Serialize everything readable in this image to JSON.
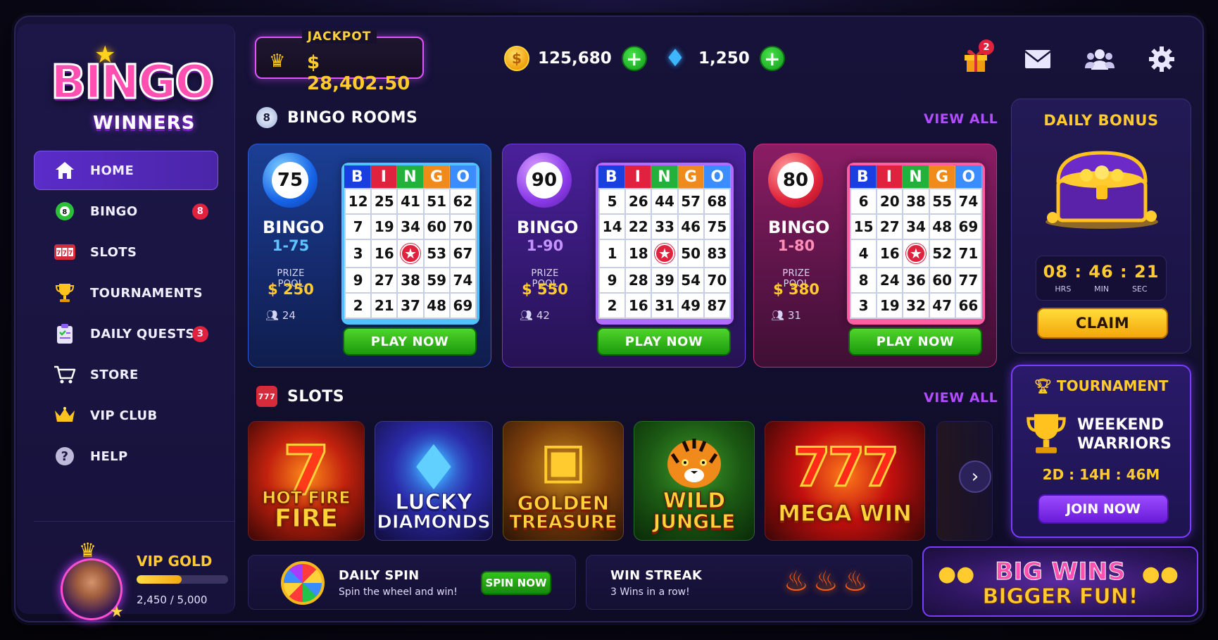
{
  "brand": {
    "line1": "BINGO",
    "line2": "WINNERS"
  },
  "nav": {
    "items": [
      {
        "label": "HOME",
        "icon": "home-icon",
        "active": true
      },
      {
        "label": "BINGO",
        "icon": "bingo-ball-icon",
        "badge": "8"
      },
      {
        "label": "SLOTS",
        "icon": "slot-machine-icon"
      },
      {
        "label": "TOURNAMENTS",
        "icon": "trophy-icon"
      },
      {
        "label": "DAILY QUESTS",
        "icon": "clipboard-icon",
        "badge": "3"
      },
      {
        "label": "STORE",
        "icon": "cart-icon"
      },
      {
        "label": "VIP CLUB",
        "icon": "crown-icon"
      },
      {
        "label": "HELP",
        "icon": "help-icon"
      }
    ]
  },
  "vip": {
    "level": "VIP GOLD",
    "progress_text": "2,450 / 5,000",
    "progress": 0.49
  },
  "header": {
    "jackpot_label": "JACKPOT",
    "jackpot_amount": "$ 28,402.50",
    "coins": "125,680",
    "gems": "1,250",
    "gift_badge": "2"
  },
  "rooms_section": {
    "title": "BINGO ROOMS",
    "view_all": "VIEW ALL"
  },
  "rooms": [
    {
      "ball": "75",
      "name": "BINGO",
      "range": "1-75",
      "prize_label": "PRIZE POOL",
      "prize": "$ 250",
      "players": "24",
      "play": "PLAY NOW",
      "letters": [
        "B",
        "I",
        "N",
        "G",
        "O"
      ],
      "grid": [
        [
          "12",
          "25",
          "41",
          "51",
          "62"
        ],
        [
          "7",
          "19",
          "34",
          "60",
          "70"
        ],
        [
          "3",
          "16",
          "★",
          "53",
          "67"
        ],
        [
          "9",
          "27",
          "38",
          "59",
          "74"
        ],
        [
          "2",
          "21",
          "37",
          "48",
          "69"
        ]
      ]
    },
    {
      "ball": "90",
      "name": "BINGO",
      "range": "1-90",
      "prize_label": "PRIZE POOL",
      "prize": "$ 550",
      "players": "42",
      "play": "PLAY NOW",
      "letters": [
        "B",
        "I",
        "N",
        "G",
        "O"
      ],
      "grid": [
        [
          "5",
          "26",
          "44",
          "57",
          "68"
        ],
        [
          "14",
          "22",
          "33",
          "46",
          "75"
        ],
        [
          "1",
          "18",
          "★",
          "50",
          "83"
        ],
        [
          "9",
          "28",
          "39",
          "54",
          "70"
        ],
        [
          "2",
          "16",
          "31",
          "49",
          "87"
        ]
      ]
    },
    {
      "ball": "80",
      "name": "BINGO",
      "range": "1-80",
      "prize_label": "PRIZE POOL",
      "prize": "$ 380",
      "players": "31",
      "play": "PLAY NOW",
      "letters": [
        "B",
        "I",
        "N",
        "G",
        "O"
      ],
      "grid": [
        [
          "6",
          "20",
          "38",
          "55",
          "74"
        ],
        [
          "15",
          "27",
          "34",
          "48",
          "69"
        ],
        [
          "4",
          "16",
          "★",
          "52",
          "71"
        ],
        [
          "8",
          "24",
          "36",
          "60",
          "77"
        ],
        [
          "3",
          "19",
          "32",
          "47",
          "66"
        ]
      ]
    }
  ],
  "slots_section": {
    "title": "SLOTS",
    "view_all": "VIEW ALL"
  },
  "slots": [
    {
      "line1": "HOT FIRE",
      "line2": "FIRE"
    },
    {
      "line1": "LUCKY",
      "line2": "DIAMONDS"
    },
    {
      "line1": "GOLDEN",
      "line2": "TREASURE"
    },
    {
      "line1": "WILD",
      "line2": "JUNGLE"
    },
    {
      "line1": "",
      "line2": "MEGA WIN"
    }
  ],
  "daily_bonus": {
    "title": "DAILY BONUS",
    "timer": "08 : 46 : 21",
    "units": [
      "HRS",
      "MIN",
      "SEC"
    ],
    "claim": "CLAIM"
  },
  "tournament": {
    "title": "TOURNAMENT",
    "name_line1": "WEEKEND",
    "name_line2": "WARRIORS",
    "time": "2D : 14H : 46M",
    "join": "JOIN NOW"
  },
  "daily_spin": {
    "title": "DAILY SPIN",
    "subtitle": "Spin the wheel and win!",
    "button": "SPIN NOW"
  },
  "win_streak": {
    "title": "WIN STREAK",
    "subtitle": "3 Wins in a row!"
  },
  "promo": {
    "line1": "BIG WINS",
    "line2": "BIGGER FUN!"
  }
}
